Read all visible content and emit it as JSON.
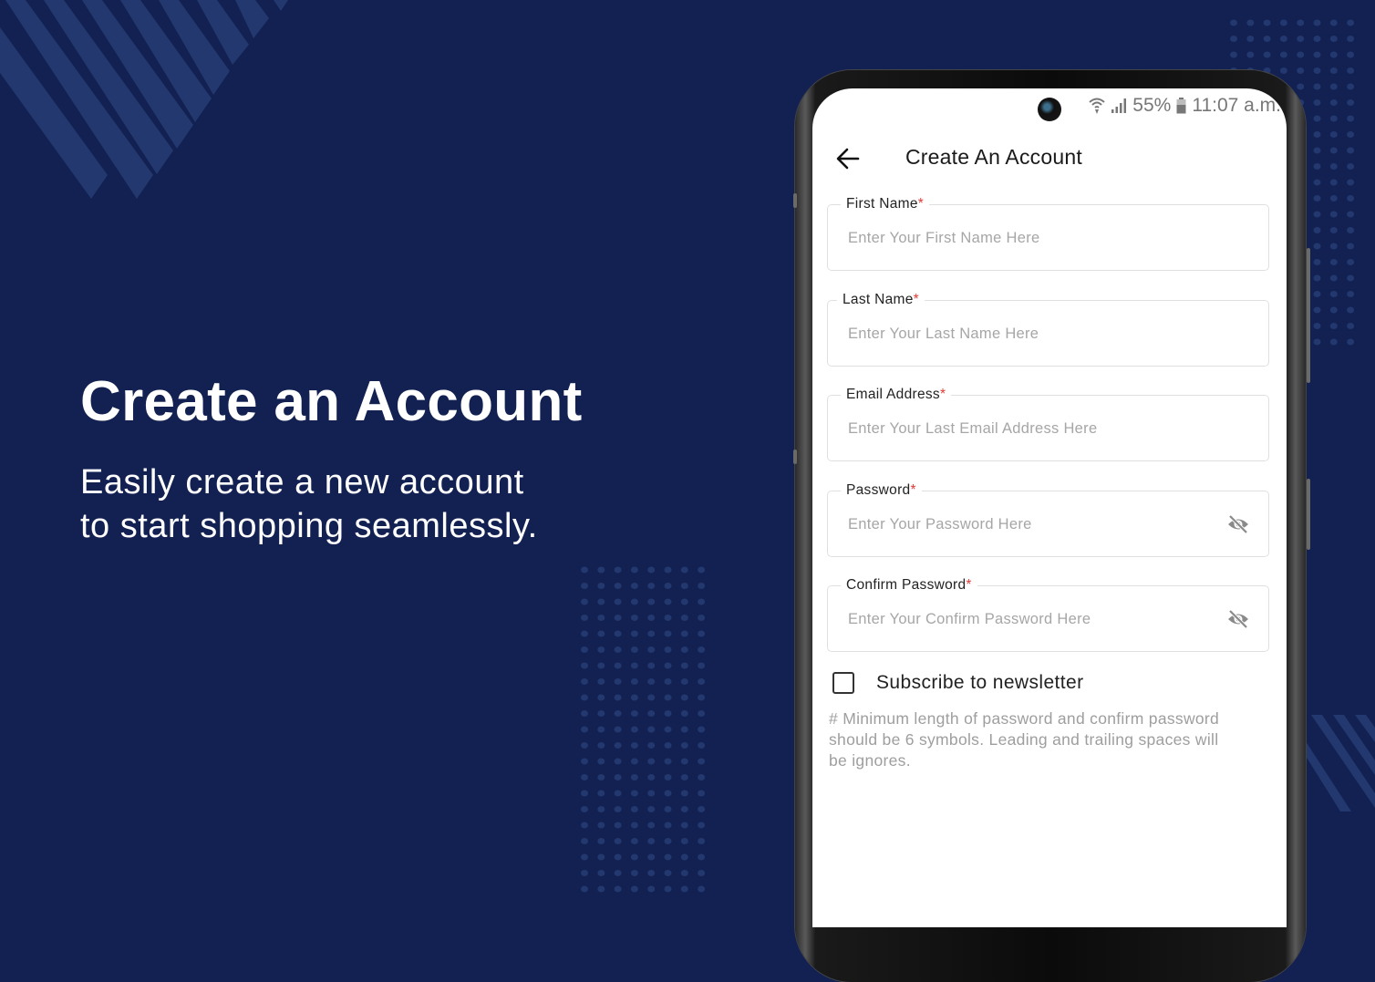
{
  "hero": {
    "title": "Create an Account",
    "subtitle": "Easily create a new account to start shopping seamlessly."
  },
  "colors": {
    "background": "#122151",
    "pattern": "#22386e",
    "required": "#e53935",
    "placeholder": "#a6a6a6"
  },
  "status_bar": {
    "icons": [
      "wifi-icon",
      "signal-icon",
      "battery-icon"
    ],
    "battery": "55%",
    "time": "11:07 a.m."
  },
  "app_bar": {
    "back_icon": "arrow-left-icon",
    "title": "Create An Account"
  },
  "form": {
    "required_marker": "*",
    "fields": [
      {
        "label": "First Name",
        "placeholder": "Enter Your First Name Here",
        "value": ""
      },
      {
        "label": "Last Name",
        "placeholder": "Enter Your Last Name Here",
        "value": ""
      },
      {
        "label": "Email Address",
        "placeholder": "Enter Your Last Email Address Here",
        "value": ""
      },
      {
        "label": "Password",
        "placeholder": "Enter Your Password Here",
        "value": "",
        "toggle_icon": "eye-off-icon"
      },
      {
        "label": "Confirm Password",
        "placeholder": "Enter Your Confirm Password Here",
        "value": "",
        "toggle_icon": "eye-off-icon"
      }
    ],
    "newsletter": {
      "label": "Subscribe to newsletter",
      "checked": false
    },
    "hint": "# Minimum length of password and confirm password should be 6 symbols. Leading and trailing spaces will be ignores."
  }
}
